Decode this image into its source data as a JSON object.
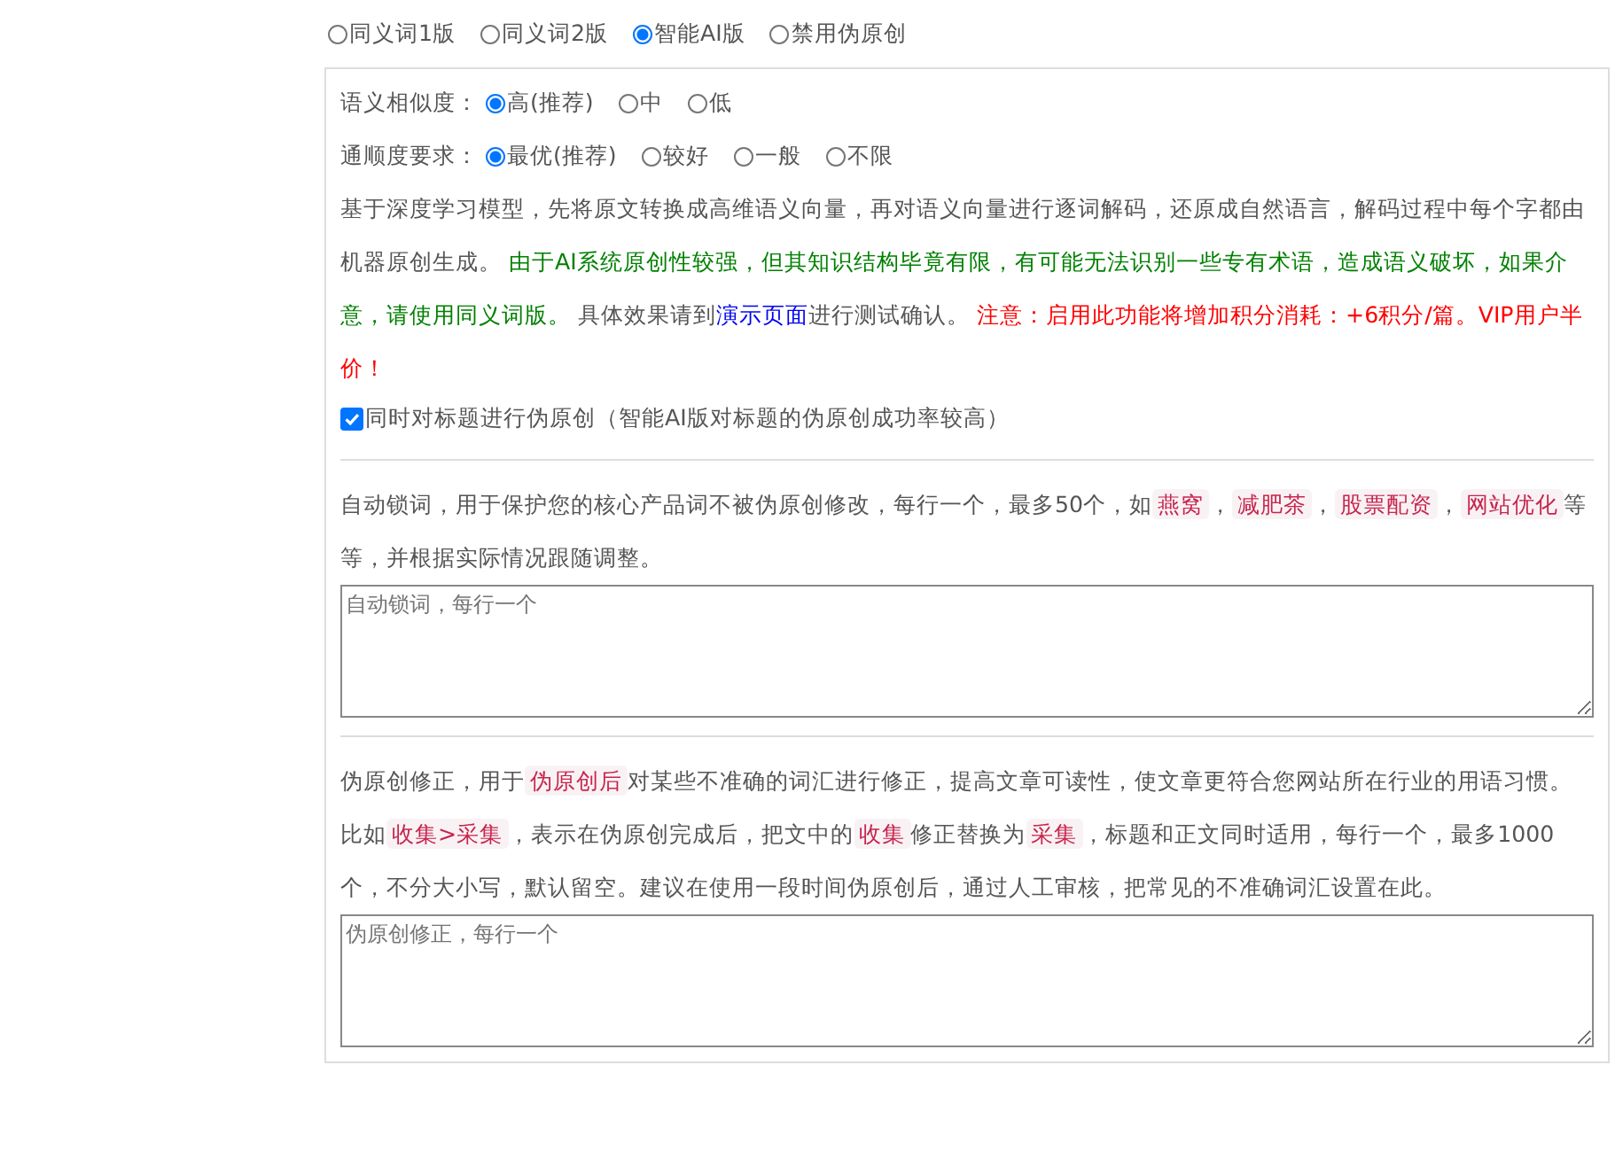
{
  "modes": [
    {
      "label": "同义词1版",
      "selected": false
    },
    {
      "label": "同义词2版",
      "selected": false
    },
    {
      "label": "智能AI版",
      "selected": true
    },
    {
      "label": "禁用伪原创",
      "selected": false
    }
  ],
  "settings": [
    {
      "label": "语义相似度：",
      "options": [
        {
          "label": "高(推荐)",
          "selected": true
        },
        {
          "label": "中",
          "selected": false
        },
        {
          "label": "低",
          "selected": false
        }
      ]
    },
    {
      "label": "通顺度要求：",
      "options": [
        {
          "label": "最优(推荐)",
          "selected": true
        },
        {
          "label": "较好",
          "selected": false
        },
        {
          "label": "一般",
          "selected": false
        },
        {
          "label": "不限",
          "selected": false
        }
      ]
    }
  ],
  "description": [
    {
      "kind": "plain",
      "text": "基于深度学习模型，先将原文转换成高维语义向量，再对语义向量进行逐词解码，还原成自然语言，解码过程中每个字都由机器原创生成。 "
    },
    {
      "kind": "green",
      "text": "由于AI系统原创性较强，但其知识结构毕竟有限，有可能无法识别一些专有术语，造成语义破坏，如果介意，请使用同义词版。"
    },
    {
      "kind": "plain",
      "text": " 具体效果请到"
    },
    {
      "kind": "link",
      "text": "演示页面"
    },
    {
      "kind": "plain",
      "text": "进行测试确认。 "
    },
    {
      "kind": "red",
      "text": "注意：启用此功能将增加积分消耗：+6积分/篇。VIP用户半价！"
    }
  ],
  "title_option": {
    "label": "同时对标题进行伪原创（智能AI版对标题的伪原创成功率较高）",
    "checked": true
  },
  "lock_words": {
    "segments": [
      {
        "kind": "plain",
        "text": "自动锁词，用于保护您的核心产品词不被伪原创修改，每行一个，最多50个，如"
      },
      {
        "kind": "tag",
        "text": "燕窝"
      },
      {
        "kind": "plain",
        "text": "，"
      },
      {
        "kind": "tag",
        "text": "减肥茶"
      },
      {
        "kind": "plain",
        "text": "，"
      },
      {
        "kind": "tag",
        "text": "股票配资"
      },
      {
        "kind": "plain",
        "text": "，"
      },
      {
        "kind": "tag",
        "text": "网站优化"
      },
      {
        "kind": "plain",
        "text": "等等，并根据实际情况跟随调整。"
      }
    ],
    "placeholder": "自动锁词，每行一个"
  },
  "correction": {
    "segments": [
      {
        "kind": "plain",
        "text": "伪原创修正，用于"
      },
      {
        "kind": "tag",
        "text": "伪原创后"
      },
      {
        "kind": "plain",
        "text": "对某些不准确的词汇进行修正，提高文章可读性，使文章更符合您网站所在行业的用语习惯。比如"
      },
      {
        "kind": "tag",
        "text": "收集>采集"
      },
      {
        "kind": "plain",
        "text": "，表示在伪原创完成后，把文中的"
      },
      {
        "kind": "tag",
        "text": "收集"
      },
      {
        "kind": "plain",
        "text": "修正替换为"
      },
      {
        "kind": "tag",
        "text": "采集"
      },
      {
        "kind": "plain",
        "text": "，标题和正文同时适用，每行一个，最多1000个，不分大小写，默认留空。建议在使用一段时间伪原创后，通过人工审核，把常见的不准确词汇设置在此。"
      }
    ],
    "placeholder": "伪原创修正，每行一个"
  }
}
